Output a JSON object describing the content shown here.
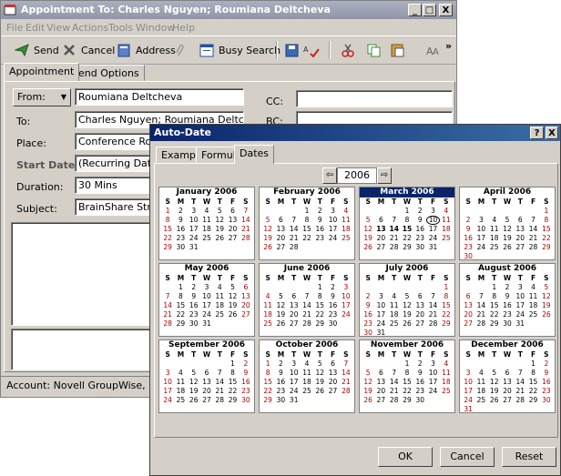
{
  "window": {
    "title": "Appointment To: Charles Nguyen; Roumiana Deltcheva",
    "controls": [
      "_",
      "□",
      "X"
    ]
  },
  "menu": [
    "File",
    "Edit",
    "View",
    "Actions",
    "Tools",
    "Window",
    "Help"
  ],
  "toolbar": {
    "send": "Send",
    "cancel": "Cancel",
    "address": "Address",
    "busy_search": "Busy Search",
    "overflow": "»"
  },
  "tabs": [
    "Appointment",
    "Send Options"
  ],
  "form": {
    "from_label": "From:",
    "from_value": "Roumiana Deltcheva",
    "to_label": "To:",
    "to_value": "Charles Nguyen; Roumiana Deltcheva",
    "place_label": "Place:",
    "place_value": "Conference Room",
    "start_label": "Start Date:",
    "start_value": "(Recurring Date)",
    "duration_label": "Duration:",
    "duration_value": "30 Mins",
    "subject_label": "Subject:",
    "subject_value": "BrainShare Strateg",
    "cc_label": "CC:",
    "bc_label": "BC:"
  },
  "status_bar": "Account: Novell GroupWise,  Folder:",
  "dialog": {
    "title": "Auto-Date",
    "help": "?",
    "close": "X",
    "tabs": [
      "Example",
      "Formula",
      "Dates"
    ],
    "year": "2006",
    "buttons": {
      "ok": "OK",
      "cancel": "Cancel",
      "reset": "Reset"
    },
    "dow": [
      "S",
      "M",
      "T",
      "W",
      "T",
      "F",
      "S"
    ],
    "months": [
      {
        "name": "January 2006",
        "start": 0,
        "days": 31
      },
      {
        "name": "February 2006",
        "start": 3,
        "days": 28
      },
      {
        "name": "March 2006",
        "start": 3,
        "days": 31,
        "bold": [
          13,
          14,
          15
        ],
        "circled": [
          10
        ]
      },
      {
        "name": "April 2006",
        "start": 6,
        "days": 30
      },
      {
        "name": "May 2006",
        "start": 1,
        "days": 31
      },
      {
        "name": "June 2006",
        "start": 4,
        "days": 30
      },
      {
        "name": "July 2006",
        "start": 6,
        "days": 31
      },
      {
        "name": "August 2006",
        "start": 2,
        "days": 31
      },
      {
        "name": "September 2006",
        "start": 5,
        "days": 30
      },
      {
        "name": "October 2006",
        "start": 0,
        "days": 31
      },
      {
        "name": "November 2006",
        "start": 3,
        "days": 30
      },
      {
        "name": "December 2006",
        "start": 5,
        "days": 31
      }
    ],
    "selected_month": 2
  },
  "colors": {
    "weekend": "#b00000",
    "selected_header": "#0a246a"
  }
}
